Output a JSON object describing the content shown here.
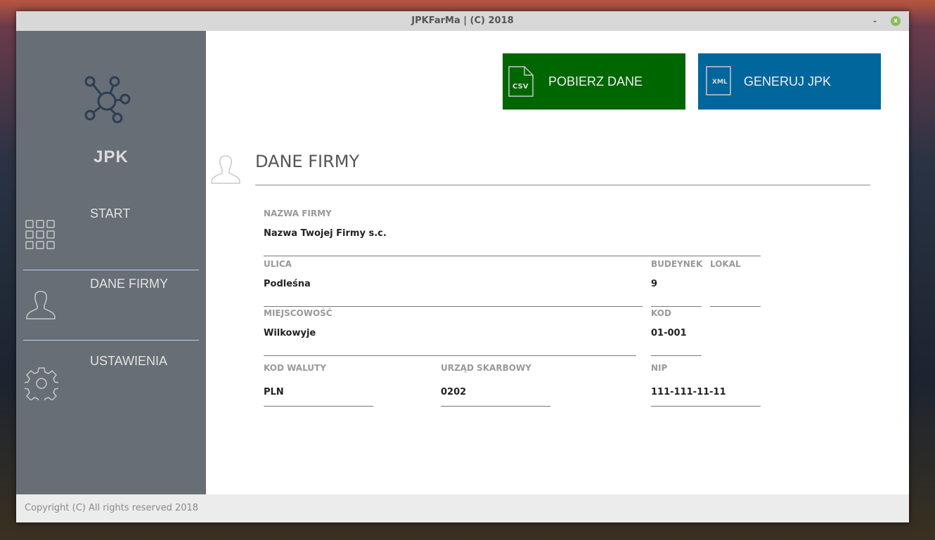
{
  "window": {
    "title": "JPKFarMa | (C) 2018",
    "minimize": "-",
    "close": "x"
  },
  "sidebar": {
    "brand": "JPK",
    "items": [
      {
        "label": "START",
        "icon": "grid-icon"
      },
      {
        "label": "DANE FIRMY",
        "icon": "user-icon"
      },
      {
        "label": "USTAWIENIA",
        "icon": "gear-icon"
      }
    ]
  },
  "toolbar": {
    "download": {
      "label": "POBIERZ DANE",
      "icon_text": "CSV",
      "color": "#006600"
    },
    "generate": {
      "label": "GENERUJ JPK",
      "icon_text": "XML",
      "color": "#00669b"
    }
  },
  "section": {
    "title": "DANE FIRMY"
  },
  "form": {
    "nazwa": {
      "label": "NAZWA FIRMY",
      "value": "Nazwa Twojej Firmy s.c."
    },
    "ulica": {
      "label": "ULICA",
      "value": "Podleśna"
    },
    "budynek": {
      "label": "BUDEYNEK",
      "value": "9"
    },
    "lokal": {
      "label": "LOKAL",
      "value": ""
    },
    "miejscowosc": {
      "label": "MIEJSCOWOŚĆ",
      "value": "Wilkowyje"
    },
    "kod": {
      "label": "KOD",
      "value": "01-001"
    },
    "waluta": {
      "label": "KOD WALUTY",
      "value": "PLN"
    },
    "urzad": {
      "label": "URZĄD SKARBOWY",
      "value": "0202"
    },
    "nip": {
      "label": "NIP",
      "value": "111-111-11-11"
    }
  },
  "footer": {
    "text": "Copyright (C) All rights reserved 2018"
  }
}
